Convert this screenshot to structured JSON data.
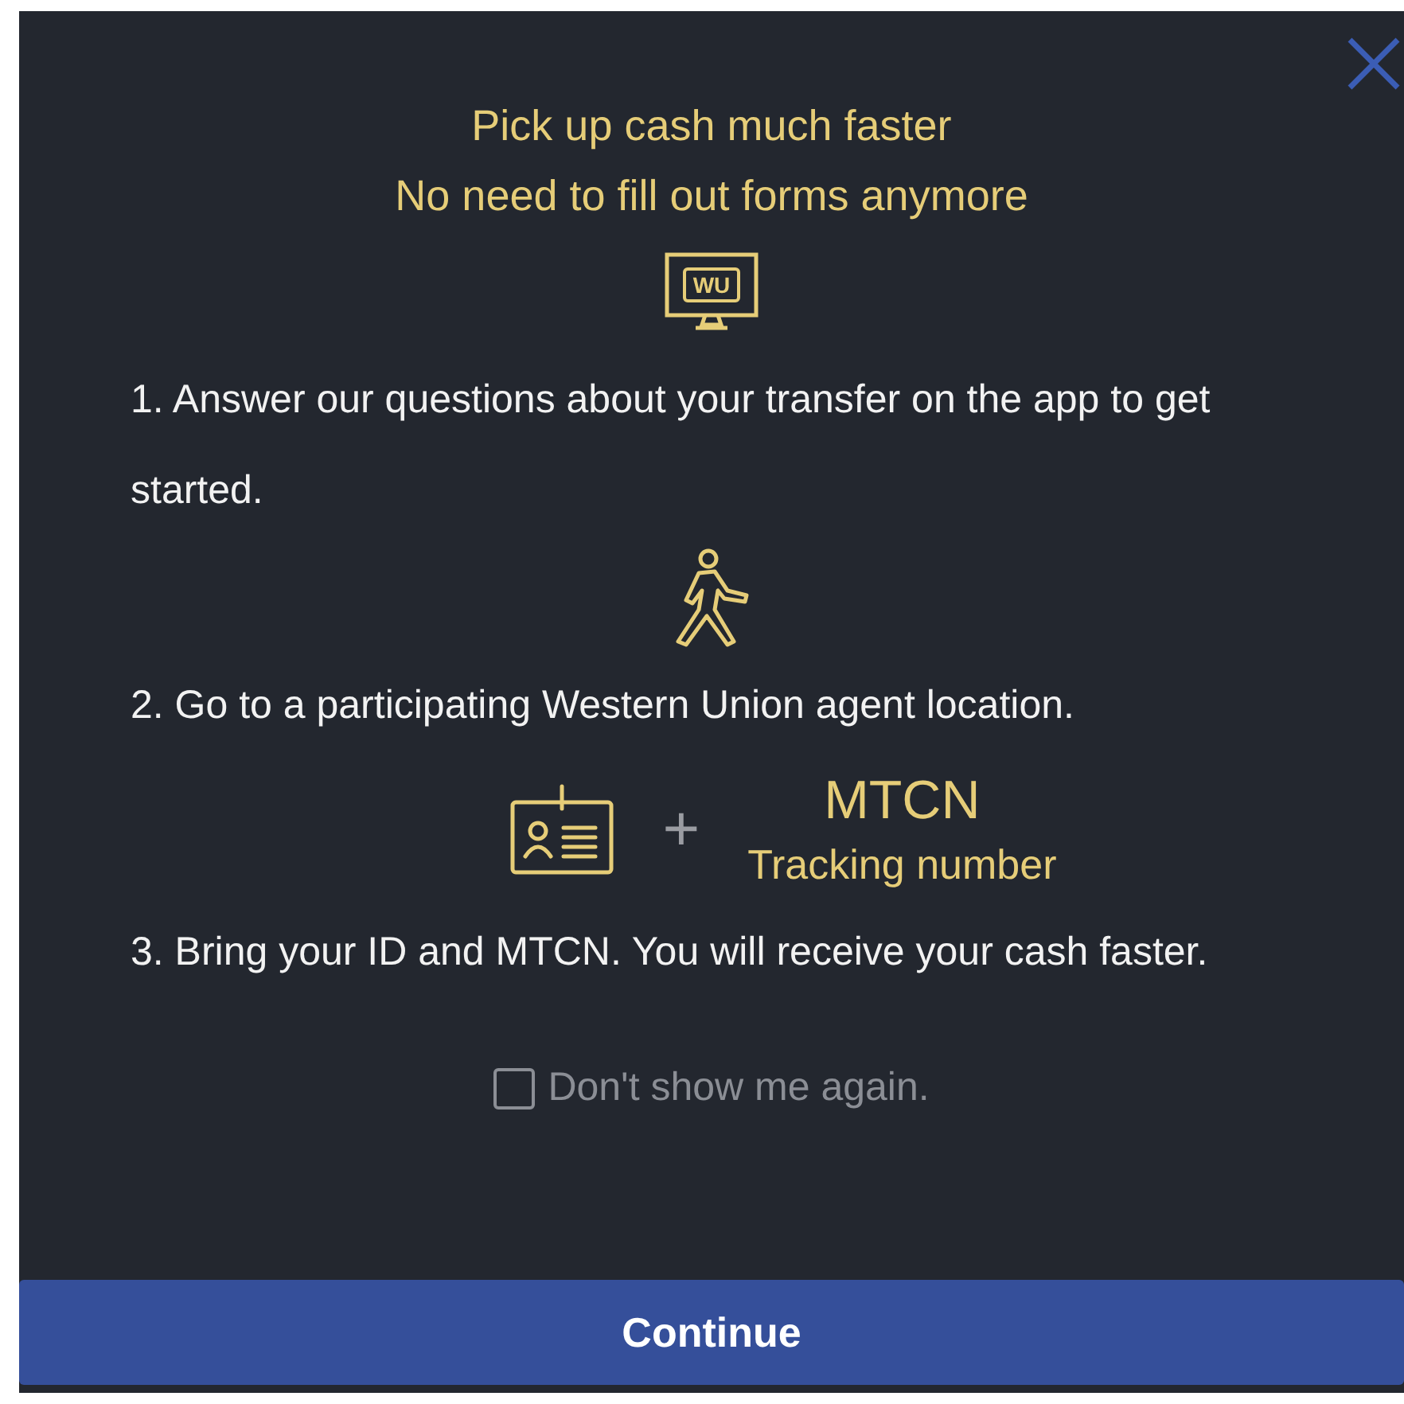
{
  "title_lines": [
    "Pick up cash much faster",
    "No need to fill out forms anymore"
  ],
  "steps": [
    {
      "kind": "monitor",
      "icon_label": "WU",
      "text": "1. Answer our questions about your transfer on the app to get started."
    },
    {
      "kind": "walker",
      "text": "2. Go to a participating Western Union agent location."
    },
    {
      "kind": "id_plus_code",
      "plus": "+",
      "code": "MTCN",
      "code_caption": "Tracking number",
      "text": "3. Bring your ID and MTCN. You will receive your cash faster."
    }
  ],
  "dont_show": {
    "label": "Don't show me again.",
    "checked": false
  },
  "button": "Continue"
}
